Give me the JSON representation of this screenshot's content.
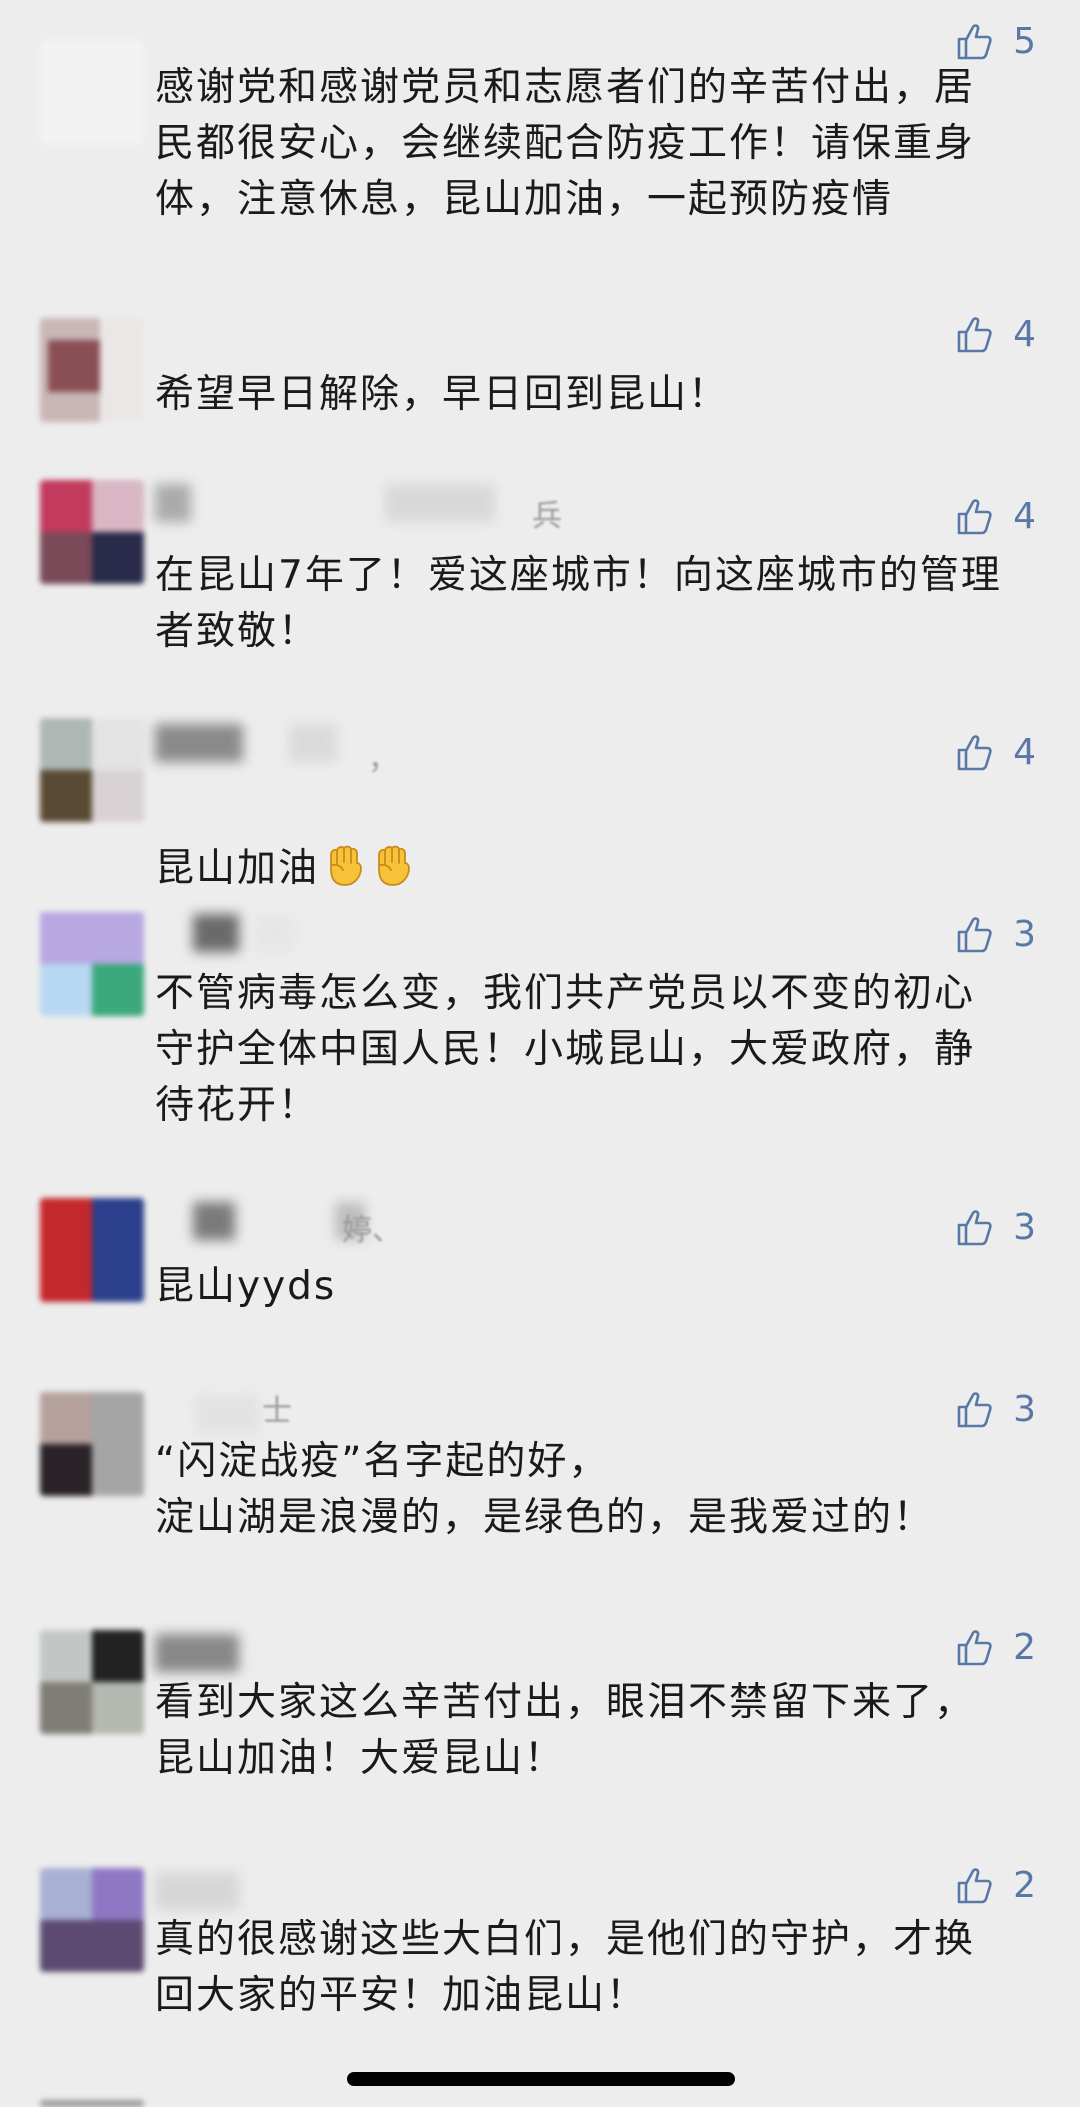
{
  "colors": {
    "background": "#ededed",
    "accent": "#5a78a6",
    "text": "#1a1a1a"
  },
  "like_icon": "thumbs-up-icon",
  "comments": [
    {
      "likes": "5",
      "name": "",
      "text": "感谢党和感谢党员和志愿者们的辛苦付出，居\n民都很安心，会继续配合防疫工作！请保重身\n体，注意休息，昆山加油，一起预防疫情"
    },
    {
      "likes": "4",
      "name": "",
      "text": "希望早日解除，早日回到昆山！"
    },
    {
      "likes": "4",
      "name": "兵",
      "text": "在昆山7年了！爱这座城市！向这座城市的管理\n者致敬！"
    },
    {
      "likes": "4",
      "name": "，",
      "text": "昆山加油"
    },
    {
      "likes": "3",
      "name": "",
      "text": "不管病毒怎么变，我们共产党员以不变的初心\n守护全体中国人民！小城昆山，大爱政府，静\n待花开！"
    },
    {
      "likes": "3",
      "name": "婷、",
      "text": "昆山yyds"
    },
    {
      "likes": "3",
      "name": "士",
      "text": "“闪淀战疫”名字起的好，\n淀山湖是浪漫的，是绿色的，是我爱过的！"
    },
    {
      "likes": "2",
      "name": "",
      "text": "看到大家这么辛苦付出，眼泪不禁留下来了，\n昆山加油！大爱昆山！"
    },
    {
      "likes": "2",
      "name": "",
      "text": "真的很感谢这些大白们，是他们的守护，才换\n回大家的平安！加油昆山！"
    }
  ],
  "emojis": [
    "raised-fist-emoji",
    "raised-fist-emoji"
  ]
}
